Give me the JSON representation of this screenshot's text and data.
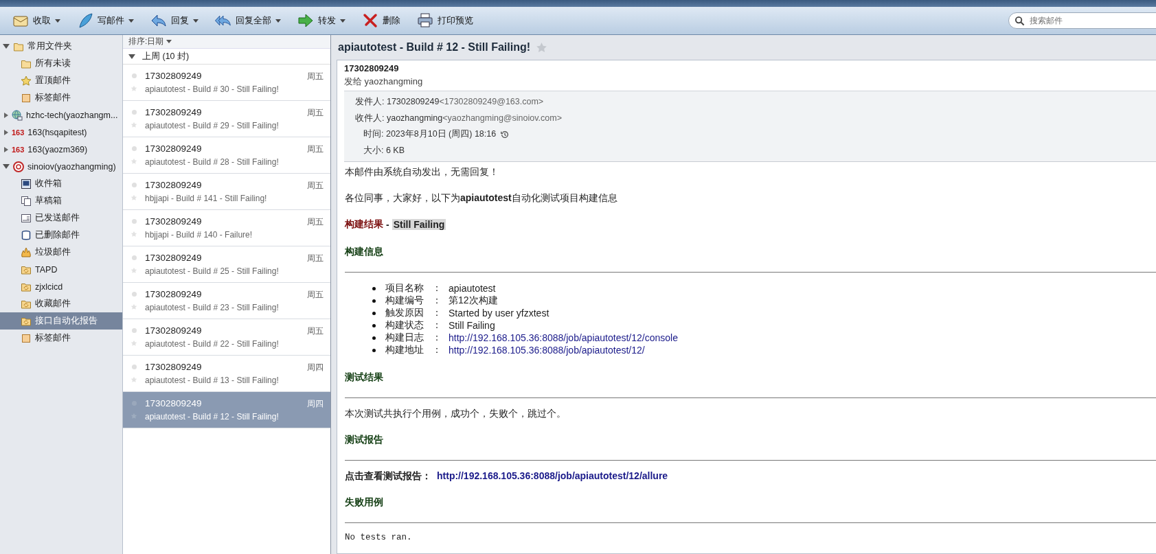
{
  "toolbar": {
    "buttons": [
      {
        "label": "收取",
        "kind": "envelope",
        "has_menu": true
      },
      {
        "label": "写邮件",
        "kind": "pen",
        "has_menu": true
      },
      {
        "label": "回复",
        "kind": "reply",
        "has_menu": true
      },
      {
        "label": "回复全部",
        "kind": "reply-all",
        "has_menu": true
      },
      {
        "label": "转发",
        "kind": "forward",
        "has_menu": true
      },
      {
        "label": "删除",
        "kind": "delete",
        "has_menu": false
      },
      {
        "label": "打印预览",
        "kind": "printer",
        "has_menu": false
      }
    ],
    "search": {
      "placeholder": "搜索邮件"
    }
  },
  "sidebar": {
    "items": [
      {
        "label": "常用文件夹",
        "kind": "folder",
        "expanded": true,
        "selected": false,
        "children": [
          {
            "label": "所有未读",
            "kind": "folder",
            "selected": false
          },
          {
            "label": "置顶邮件",
            "kind": "star",
            "selected": false
          },
          {
            "label": "标签邮件",
            "kind": "tag",
            "selected": false
          }
        ]
      },
      {
        "label": "hzhc-tech(yaozhangm...",
        "kind": "globe",
        "expanded": false,
        "selected": false
      },
      {
        "label": "163(hsqapitest)",
        "kind": "logo",
        "logo": "163",
        "expanded": false,
        "selected": false
      },
      {
        "label": "163(yaozm369)",
        "kind": "logo",
        "logo": "163",
        "expanded": false,
        "selected": false
      },
      {
        "label": "sinoiov(yaozhangming)",
        "kind": "account",
        "expanded": true,
        "selected": false,
        "children": [
          {
            "label": "收件箱",
            "kind": "inbox",
            "selected": false
          },
          {
            "label": "草稿箱",
            "kind": "drafts",
            "selected": false
          },
          {
            "label": "已发送邮件",
            "kind": "sent",
            "selected": false
          },
          {
            "label": "已删除邮件",
            "kind": "trash",
            "selected": false
          },
          {
            "label": "垃圾邮件",
            "kind": "junk",
            "selected": false
          },
          {
            "label": "TAPD",
            "kind": "sync-folder",
            "selected": false
          },
          {
            "label": "zjxlcicd",
            "kind": "sync-folder",
            "selected": false
          },
          {
            "label": "收藏邮件",
            "kind": "sync-folder",
            "selected": false
          },
          {
            "label": "接口自动化报告",
            "kind": "sync-folder",
            "selected": true
          },
          {
            "label": "标签邮件",
            "kind": "tag",
            "selected": false
          }
        ]
      }
    ]
  },
  "mail_list": {
    "sort": "排序:日期",
    "group": {
      "label": "上周 (10 封)",
      "expanded": true
    },
    "messages": [
      {
        "sender": "17302809249",
        "subject": "apiautotest - Build # 30 - Still Failing!",
        "day": "周五",
        "selected": false
      },
      {
        "sender": "17302809249",
        "subject": "apiautotest - Build # 29 - Still Failing!",
        "day": "周五",
        "selected": false
      },
      {
        "sender": "17302809249",
        "subject": "apiautotest - Build # 28 - Still Failing!",
        "day": "周五",
        "selected": false
      },
      {
        "sender": "17302809249",
        "subject": "hbjjapi - Build # 141 - Still Failing!",
        "day": "周五",
        "selected": false
      },
      {
        "sender": "17302809249",
        "subject": "hbjjapi - Build # 140 - Failure!",
        "day": "周五",
        "selected": false
      },
      {
        "sender": "17302809249",
        "subject": "apiautotest - Build # 25 - Still Failing!",
        "day": "周五",
        "selected": false
      },
      {
        "sender": "17302809249",
        "subject": "apiautotest - Build # 23 - Still Failing!",
        "day": "周五",
        "selected": false
      },
      {
        "sender": "17302809249",
        "subject": "apiautotest - Build # 22 - Still Failing!",
        "day": "周五",
        "selected": false
      },
      {
        "sender": "17302809249",
        "subject": "apiautotest - Build # 13 - Still Failing!",
        "day": "周四",
        "selected": false
      },
      {
        "sender": "17302809249",
        "subject": "apiautotest - Build # 12 - Still Failing!",
        "day": "周四",
        "selected": true
      }
    ]
  },
  "reader": {
    "title": "apiautotest - Build # 12 - Still Failing!",
    "starred": false,
    "sender": "17302809249",
    "sent_to": "发给 yaozhangming",
    "details": [
      {
        "label": "发件人:",
        "value": "17302809249",
        "address": "<17302809249@163.com>",
        "kind": "address"
      },
      {
        "label": "收件人:",
        "value": "yaozhangming",
        "address": "<yaozhangming@sinoiov.com>",
        "kind": "address"
      },
      {
        "label": "时间:",
        "value": "2023年8月10日 (周四) 18:16",
        "kind": "time"
      },
      {
        "label": "大小:",
        "value": "6 KB",
        "kind": "plain"
      }
    ],
    "body": {
      "notice": "本邮件由系统自动发出，无需回复！",
      "greeting": "各位同事，大家好，以下为**apiautotest**自动化测试项目构建信息",
      "result": {
        "label": "构建结果",
        "separator": "-",
        "value": "Still Failing"
      },
      "build_info": {
        "heading": "构建信息",
        "items": [
          {
            "label": "项目名称",
            "separator": "：",
            "value": "apiautotest",
            "kind": "text"
          },
          {
            "label": "构建编号",
            "separator": "：",
            "value": "第12次构建",
            "kind": "text"
          },
          {
            "label": "触发原因",
            "separator": "：",
            "value": "Started by user yfzxtest",
            "kind": "text"
          },
          {
            "label": "构建状态",
            "separator": "：",
            "value": "Still Failing",
            "kind": "text"
          },
          {
            "label": "构建日志",
            "separator": "：",
            "value": "http://192.168.105.36:8088/job/apiautotest/12/console",
            "kind": "link"
          },
          {
            "label": "构建地址",
            "separator": "：",
            "value": "http://192.168.105.36:8088/job/apiautotest/12/",
            "kind": "link"
          }
        ]
      },
      "test_result": {
        "heading": "测试结果",
        "text": "本次测试共执行个用例，成功个，失败个，跳过个。"
      },
      "test_report": {
        "heading": "测试报告",
        "label": "点击查看测试报告：",
        "link": "http://192.168.105.36:8088/job/apiautotest/12/allure"
      },
      "failed_cases": {
        "heading": "失败用例",
        "text": "No tests ran."
      }
    }
  }
}
